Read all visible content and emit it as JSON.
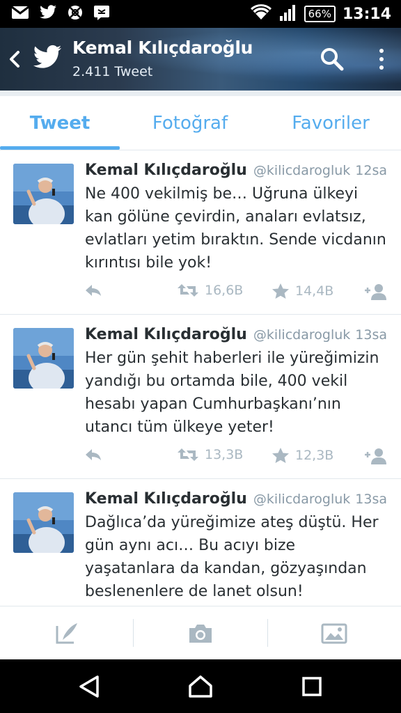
{
  "status_bar": {
    "battery": "66%",
    "time": "13:14",
    "icons": [
      "gmail-icon",
      "twitter-icon",
      "no-disturb-icon",
      "message-icon",
      "wifi-icon",
      "signal-icon",
      "battery-icon"
    ]
  },
  "header": {
    "title": "Kemal Kılıçdaroğlu",
    "subtitle": "2.411 Tweet"
  },
  "tabs": [
    {
      "label": "Tweet",
      "active": true
    },
    {
      "label": "Fotoğraf",
      "active": false
    },
    {
      "label": "Favoriler",
      "active": false
    }
  ],
  "tweets": [
    {
      "name": "Kemal Kılıçdaroğlu",
      "handle": "@kilicdarogluk",
      "time": "12sa",
      "lines": [
        "Ne 400 vekilmiş be… Uğruna ülkeyi",
        "kan gölüne çevirdin, anaları evlatsız,",
        "evlatları yetim bıraktın. Sende vicdanın",
        "kırıntısı bile yok!"
      ],
      "retweets": "16,6B",
      "favorites": "14,4B"
    },
    {
      "name": "Kemal Kılıçdaroğlu",
      "handle": "@kilicdarogluk",
      "time": "13sa",
      "lines": [
        "Her gün şehit haberleri ile yüreğimizin",
        "yandığı bu ortamda bile, 400 vekil",
        "hesabı yapan Cumhurbaşkanı’nın",
        "utancı tüm ülkeye yeter!"
      ],
      "retweets": "13,3B",
      "favorites": "12,3B"
    },
    {
      "name": "Kemal Kılıçdaroğlu",
      "handle": "@kilicdarogluk",
      "time": "13sa",
      "lines": [
        "Dağlıca’da yüreğimize ateş düştü. Her",
        "gün aynı acı… Bu acıyı bize",
        "yaşatanlara da kandan, gözyaşından",
        "beslenenlere de lanet olsun!"
      ]
    }
  ],
  "colors": {
    "accent": "#55acee",
    "text": "#292f33",
    "muted": "#8899a6",
    "icon": "#aab8c2"
  }
}
